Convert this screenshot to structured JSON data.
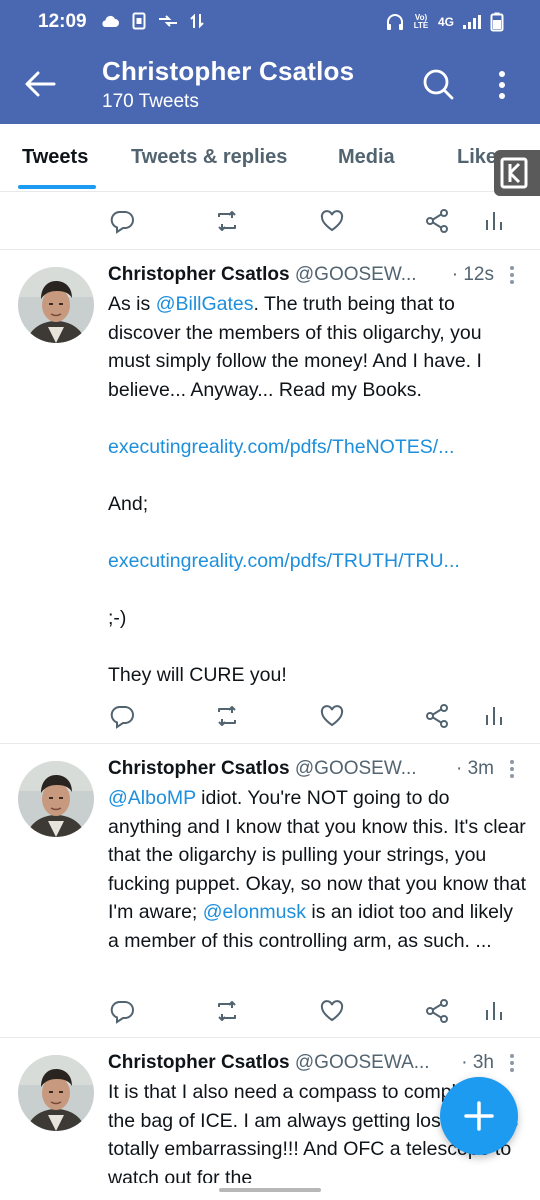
{
  "status_bar": {
    "time": "12:09",
    "lte_label": "Vo) LTE",
    "network": "4G",
    "icons": [
      "cloud-icon",
      "sim-icon",
      "data-transfer-icon",
      "sync-arrows-icon",
      "headphones-icon",
      "signal-icon",
      "battery-icon"
    ]
  },
  "header": {
    "title": "Christopher Csatlos",
    "subtitle": "170 Tweets"
  },
  "tabs": [
    {
      "label": "Tweets",
      "active": true
    },
    {
      "label": "Tweets & replies",
      "active": false
    },
    {
      "label": "Media",
      "active": false
    },
    {
      "label": "Likes",
      "active": false
    }
  ],
  "colors": {
    "header": "#4a68b2",
    "accent": "#1d9bf0",
    "link": "#1d8fdc",
    "muted": "#536471"
  },
  "tweets": [
    {
      "name": "Christopher Csatlos",
      "handle": "@GOOSEW...",
      "time": "· 12s",
      "body": {
        "line1_mention": "@BillGates",
        "line1_rest": ". The truth being that to discover the members of this oligarchy, you must simply follow the money! And I have. I believe... Anyway... Read my Books.",
        "line1_prefix": "As is ",
        "link1": "executingreality.com/pdfs/TheNOTES/...",
        "text2": "And;",
        "link2": "executingreality.com/pdfs/TRUTH/TRU...",
        "text3": ";-)",
        "text4": "They will CURE you!"
      }
    },
    {
      "name": "Christopher Csatlos",
      "handle": "@GOOSEW...",
      "time": "· 3m",
      "body": {
        "mention1": "@AlboMP",
        "text1": " idiot. You're NOT going to do anything and I know that you know this. It's clear that the oligarchy is pulling your strings, you fucking puppet. Okay, so now that you know that I'm aware; ",
        "mention2": "@elonmusk",
        "text2": " is an idiot too and likely a member of this controlling arm, as such. ..."
      }
    },
    {
      "name": "Christopher Csatlos",
      "handle": "@GOOSEWA...",
      "time": "· 3h",
      "body": {
        "text": "It is that I also need a compass to compliment the bag of ICE. I am always getting lost omg it's totally embarrassing!!! And OFC a telescope to watch out for the"
      }
    }
  ]
}
